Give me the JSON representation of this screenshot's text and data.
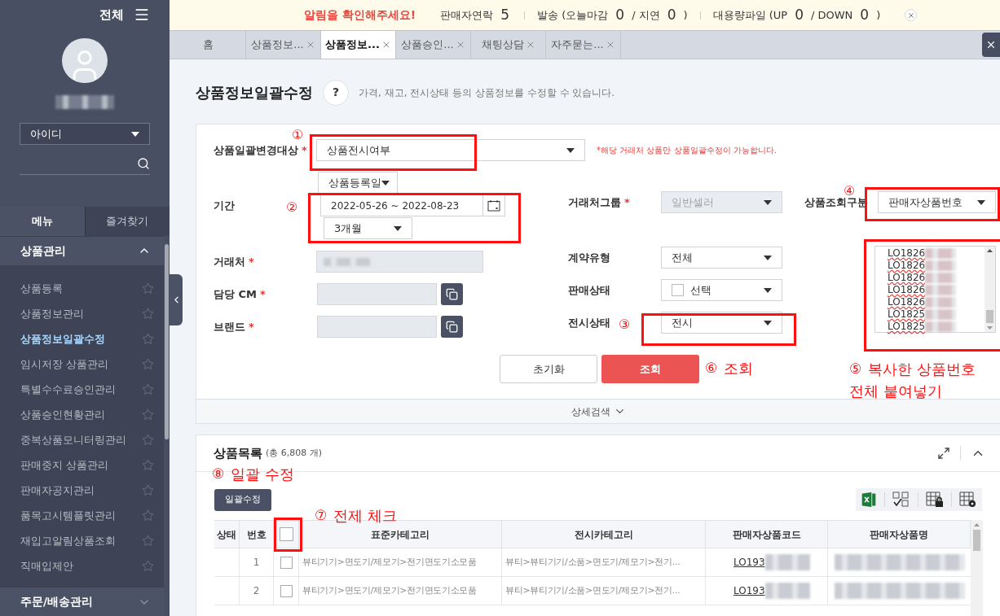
{
  "sidebar": {
    "all_label": "전체",
    "id_select": "아이디",
    "tabs": [
      {
        "label": "메뉴",
        "selected": true
      },
      {
        "label": "즐겨찾기",
        "selected": false
      }
    ],
    "sections": [
      {
        "title": "상품관리",
        "expanded": true,
        "items": [
          {
            "label": "상품등록",
            "selected": false
          },
          {
            "label": "상품정보관리",
            "selected": false
          },
          {
            "label": "상품정보일괄수정",
            "selected": true
          },
          {
            "label": "임시저장 상품관리",
            "selected": false
          },
          {
            "label": "특별수수료승인관리",
            "selected": false
          },
          {
            "label": "상품승인현황관리",
            "selected": false
          },
          {
            "label": "중복상품모니터링관리",
            "selected": false
          },
          {
            "label": "판매중지 상품관리",
            "selected": false
          },
          {
            "label": "판매자공지관리",
            "selected": false
          },
          {
            "label": "품목고시템플릿관리",
            "selected": false
          },
          {
            "label": "재입고알림상품조회",
            "selected": false
          },
          {
            "label": "직매입제안",
            "selected": false
          }
        ]
      },
      {
        "title": "주문/배송관리",
        "expanded": false
      }
    ]
  },
  "notice_bar": {
    "alert": "알림을 확인해주세요!",
    "items": [
      {
        "segments": [
          {
            "kind": "label",
            "text": "판매자연락"
          },
          {
            "kind": "count",
            "text": "5"
          }
        ]
      },
      {
        "segments": [
          {
            "kind": "label",
            "text": "발송 (오늘마감"
          },
          {
            "kind": "count",
            "text": "0"
          },
          {
            "kind": "label",
            "text": "/ 지연"
          },
          {
            "kind": "count",
            "text": "0"
          },
          {
            "kind": "label",
            "text": ")"
          }
        ]
      },
      {
        "segments": [
          {
            "kind": "label",
            "text": "대용량파일 (UP"
          },
          {
            "kind": "count",
            "text": "0"
          },
          {
            "kind": "label",
            "text": "/ DOWN"
          },
          {
            "kind": "count",
            "text": "0"
          },
          {
            "kind": "label",
            "text": ")"
          }
        ]
      }
    ]
  },
  "tabs": [
    {
      "label": "홈",
      "closable": false,
      "selected": false
    },
    {
      "label": "상품정보...",
      "closable": true,
      "selected": false
    },
    {
      "label": "상품정보...",
      "closable": true,
      "selected": true
    },
    {
      "label": "상품승인...",
      "closable": true,
      "selected": false
    },
    {
      "label": "채팅상담",
      "closable": true,
      "selected": false
    },
    {
      "label": "자주묻는...",
      "closable": true,
      "selected": false
    }
  ],
  "page": {
    "title": "상품정보일괄수정",
    "help": "?",
    "description": "가격, 재고, 전시상태 등의 상품정보를 수정할 수 있습니다."
  },
  "form": {
    "target": {
      "label": "상품일괄변경대상",
      "mark": "*",
      "value": "상품전시여부",
      "note": "*해당 거래처 상품만 상품일괄수정이 가능합니다."
    },
    "date_type": "상품등록일",
    "period": {
      "label": "기간",
      "range": "2022-05-26 ~ 2022-08-23",
      "preset": "3개월"
    },
    "partner": {
      "label": "거래처",
      "mark": "*"
    },
    "cm": {
      "label": "담당 CM",
      "mark": "*"
    },
    "brand": {
      "label": "브랜드",
      "mark": "*"
    },
    "partner_group": {
      "label": "거래처그룹",
      "mark": "*",
      "value": "일반셀러",
      "disabled": true
    },
    "contract_type": {
      "label": "계약유형",
      "value": "전체"
    },
    "sale_status": {
      "label": "판매상태",
      "value": "선택",
      "checked": false
    },
    "display_status": {
      "label": "전시상태",
      "value": "전시"
    },
    "lookup_type": {
      "label": "상품조회구분",
      "value": "판매자상품번호"
    },
    "product_numbers": [
      "LO1826",
      "LO1826",
      "LO1826",
      "LO1826",
      "LO1826",
      "LO1825",
      "LO1825"
    ],
    "buttons": [
      {
        "label": "초기화",
        "kind": "secondary"
      },
      {
        "label": "조회",
        "kind": "primary"
      }
    ],
    "detail_search": "상세검색"
  },
  "list": {
    "title": "상품목록",
    "count": "(총 6,808 개)",
    "bulk_button": "일괄수정",
    "header_checked": false,
    "columns": [
      "상태",
      "번호",
      "표준카테고리",
      "전시카테고리",
      "판매자상품코드",
      "판매자상품명"
    ],
    "rows": [
      {
        "number": "1",
        "checked": false,
        "std_category": "뷰티기기>면도기/제모기>전기면도기소모품",
        "display_category": "뷰티>뷰티기기/소품>면도기/제모기>전기...",
        "code": "LO193"
      },
      {
        "number": "2",
        "checked": false,
        "std_category": "뷰티기기>면도기/제모기>전기면도기소모품",
        "display_category": "뷰티>뷰티기기/소품>면도기/제모기>전기...",
        "code": "LO193"
      }
    ]
  },
  "annotations": [
    {
      "number": "①",
      "boxed": true
    },
    {
      "number": "②",
      "boxed": true
    },
    {
      "number": "③",
      "boxed": true
    },
    {
      "number": "④",
      "boxed": true
    },
    {
      "number": "⑥",
      "text_lines": [
        "조회"
      ],
      "boxed": false
    },
    {
      "number": "⑤",
      "text_lines": [
        "복사한 상품번호",
        "전체 붙여넣기"
      ],
      "boxed": true
    },
    {
      "number": "⑦",
      "text_lines": [
        "전제 체크"
      ],
      "boxed": true
    },
    {
      "number": "⑧",
      "text_lines": [
        "일괄 수정"
      ],
      "boxed": false
    }
  ]
}
